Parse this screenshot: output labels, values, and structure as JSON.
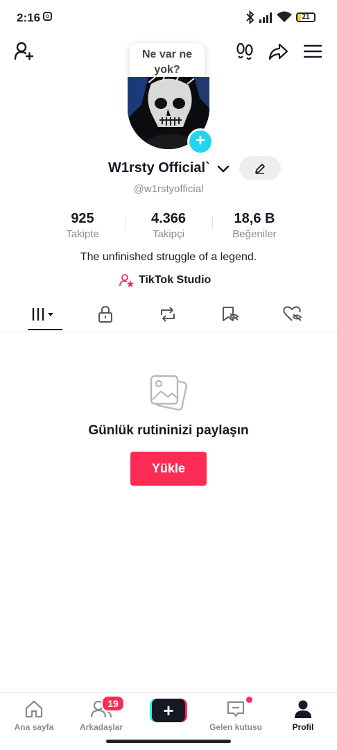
{
  "status_bar": {
    "time": "2:16",
    "battery": "21",
    "battery_level": 0.21
  },
  "tooltip": {
    "text": "Ne var ne yok?"
  },
  "profile": {
    "display_name": "W1rsty Official`",
    "handle": "@w1rstyofficial",
    "bio": "The unfinished struggle of a legend."
  },
  "stats": [
    {
      "value": "925",
      "label": "Takipte"
    },
    {
      "value": "4.366",
      "label": "Takipçi"
    },
    {
      "value": "18,6 B",
      "label": "Beğeniler"
    }
  ],
  "studio_link": {
    "label": "TikTok Studio"
  },
  "empty_state": {
    "title": "Günlük rutininizi paylaşın",
    "button": "Yükle"
  },
  "bottom_nav": {
    "items": [
      {
        "label": "Ana sayfa"
      },
      {
        "label": "Arkadaşlar"
      },
      {
        "label": ""
      },
      {
        "label": "Gelen kutusu"
      },
      {
        "label": "Profil"
      }
    ],
    "friends_badge": "19"
  },
  "icons": {
    "top_left": "add-friend-icon",
    "top_right": [
      "footprints-icon",
      "share-icon",
      "menu-icon"
    ],
    "tabs": [
      "videos-grid-icon",
      "lock-icon",
      "repost-icon",
      "favorites-hidden-icon",
      "liked-hidden-icon"
    ]
  },
  "colors": {
    "accent": "#fe2c55",
    "cyan": "#25f4ee",
    "badge_blue": "#20d5ec"
  }
}
